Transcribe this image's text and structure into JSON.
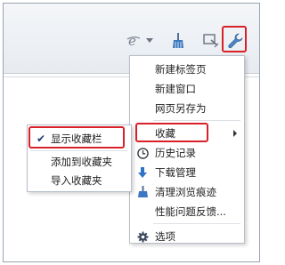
{
  "colors": {
    "highlight": "#d9212a",
    "accent": "#2f73c6"
  },
  "toolbar": {
    "icons": [
      "ie-compat-icon",
      "dropdown-icon",
      "clean-broom-icon",
      "screenshot-icon",
      "tools-wrench-icon"
    ]
  },
  "main_menu": {
    "items": [
      {
        "label": "新建标签页",
        "icon": ""
      },
      {
        "label": "新建窗口",
        "icon": ""
      },
      {
        "label": "网页另存为",
        "icon": ""
      },
      {
        "label": "收藏",
        "icon": "",
        "has_submenu": true
      },
      {
        "label": "历史记录",
        "icon": "clock-icon"
      },
      {
        "label": "下载管理",
        "icon": "download-arrow-icon"
      },
      {
        "label": "清理浏览痕迹",
        "icon": "broom-icon"
      },
      {
        "label": "性能问题反馈...",
        "icon": ""
      },
      {
        "label": "选项",
        "icon": "gear-icon"
      }
    ]
  },
  "submenu": {
    "items": [
      {
        "label": "显示收藏栏",
        "checked": true,
        "check_glyph": "✔"
      },
      {
        "label": "添加到收藏夹",
        "checked": false
      },
      {
        "label": "导入收藏夹",
        "checked": false
      }
    ]
  }
}
